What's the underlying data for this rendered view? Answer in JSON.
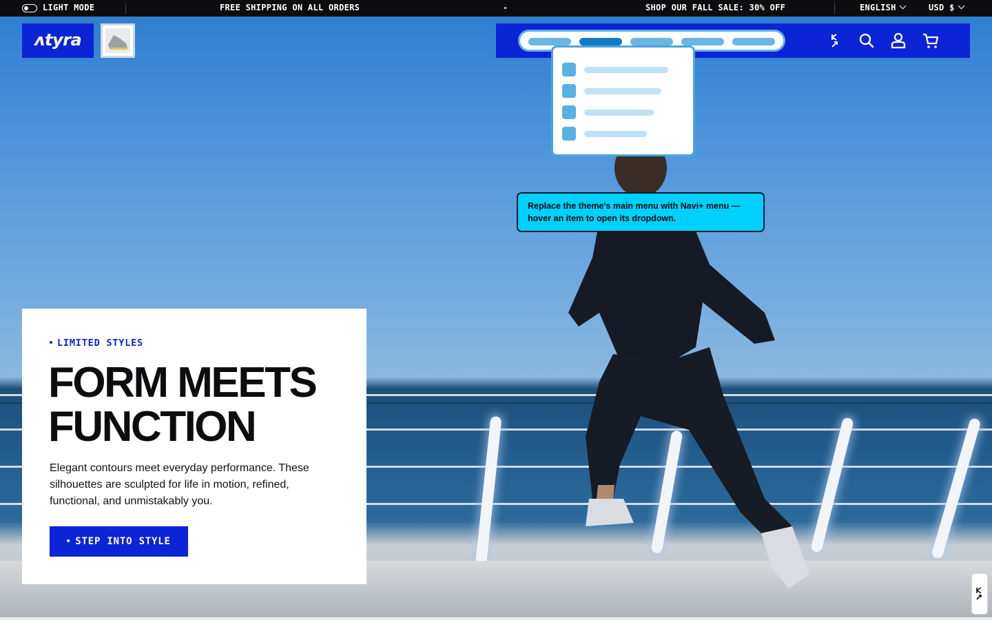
{
  "announcement": {
    "theme_toggle_label": "LIGHT MODE",
    "message_1": "FREE SHIPPING ON ALL ORDERS",
    "separator": "-",
    "message_2": "SHOP OUR FALL SALE: 30% OFF",
    "language": "ENGLISH",
    "currency": "USD $"
  },
  "header": {
    "logo_text": "ʌtyra",
    "icons": [
      "navi-plus-icon",
      "search-icon",
      "account-icon",
      "cart-icon"
    ]
  },
  "navi_menu": {
    "active_index": 1,
    "item_count": 5,
    "dropdown_item_count": 4
  },
  "tooltip": {
    "text": "Replace the theme's main menu with Navi+ menu — hover an item to open its dropdown."
  },
  "hero": {
    "eyebrow": "LIMITED STYLES",
    "headline_line1": "FORM MEETS",
    "headline_line2": "FUNCTION",
    "description": "Elegant contours meet everyday performance. These silhouettes are sculpted for life in motion, refined, functional, and unmistakably you.",
    "cta_label": "STEP INTO STYLE"
  },
  "colors": {
    "brand_blue": "#0b24d6",
    "announcement_bg": "#0d0d0f",
    "tooltip_bg": "#00d0ff",
    "navi_accent": "#4aa7dc"
  }
}
